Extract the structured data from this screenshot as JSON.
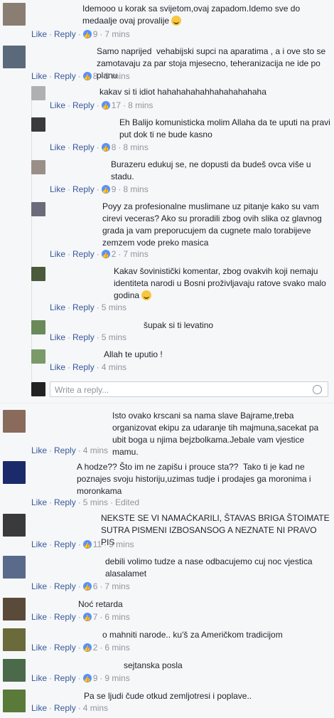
{
  "actions": {
    "like": "Like",
    "reply": "Reply"
  },
  "write_placeholder": "Write a reply...",
  "comments": [
    {
      "text": "Idemooo u korak sa svijetom,ovaj zapadom.Idemo sve do medaalje ovaj provalije",
      "likes": "9",
      "time": "7 mins"
    },
    {
      "text": "Samo naprijed  vehabijski supci na aparatima , a i ove sto se zamotavaju za par stoja mjesecno, teheranizacija ne ide po planu",
      "likes": "8",
      "time": "9 mins"
    },
    {
      "text": "kakav si ti idiot hahahahahahhahahahahaha",
      "likes": "17",
      "time": "8 mins"
    },
    {
      "text": "Eh Balijo komunisticka molim Allaha da te uputi na pravi put dok ti ne bude kasno",
      "likes": "8",
      "time": "8 mins"
    },
    {
      "text": "Burazeru edukuj se, ne dopusti da budeš ovca više u stadu.",
      "likes": "9",
      "time": "8 mins"
    },
    {
      "text": "Poyy za profesionalne muslimane uz pitanje kako su vam cirevi veceras? Ako su proradili zbog ovih slika oz glavnog grada ja vam preporucujem da cugnete malo torabijeve zemzem vode preko masica",
      "likes": "2",
      "time": "7 mins"
    },
    {
      "text": "Kakav šovinistički komentar, zbog ovakvih koji nemaju identiteta narodi u Bosni proživljavaju ratove svako malo godina",
      "likes": "",
      "time": "5 mins"
    },
    {
      "text": "šupak si ti levatino",
      "likes": "",
      "time": "5 mins"
    },
    {
      "text": "Allah te uputio !",
      "likes": "",
      "time": "4 mins"
    },
    {
      "text": "Isto ovako krscani sa nama slave Bajrame,treba organizovat ekipu za udaranje tih majmuna,sacekat pa ubit boga u njima bejzbolkama.Jebale vam vjestice mamu.",
      "likes": "",
      "time": "4 mins"
    },
    {
      "text": "A hodze?? Što im ne zapišu i prouce sta??  Tako ti je kad ne poznajes svoju historiju,uzimas tudje i prodajes ga moronima i moronkama",
      "likes": "",
      "time": "5 mins",
      "edited": "Edited"
    },
    {
      "text": "NEKSTE SE VI NAMAĆKARILI, ŠTAVAS BRIGA ŠTOIMATE SUTRA PISMENI IZBOSANSOG A NEZNATE NI PRAVO PIS",
      "likes": "11",
      "time": "9 mins"
    },
    {
      "text": "debili volimo tudze a nase odbacujemo cuj noc vjestica alasalamet",
      "likes": "6",
      "time": "7 mins"
    },
    {
      "text": "Noć retarda",
      "likes": "7",
      "time": "6 mins"
    },
    {
      "text": "o mahniti narode.. ku'š za Američkom tradicijom",
      "likes": "2",
      "time": "6 mins"
    },
    {
      "text": "sejtanska posla",
      "likes": "9",
      "time": "9 mins"
    },
    {
      "text": "Pa se ljudi čude otkud zemljotresi i poplave..",
      "likes": "",
      "time": "4 mins"
    }
  ]
}
